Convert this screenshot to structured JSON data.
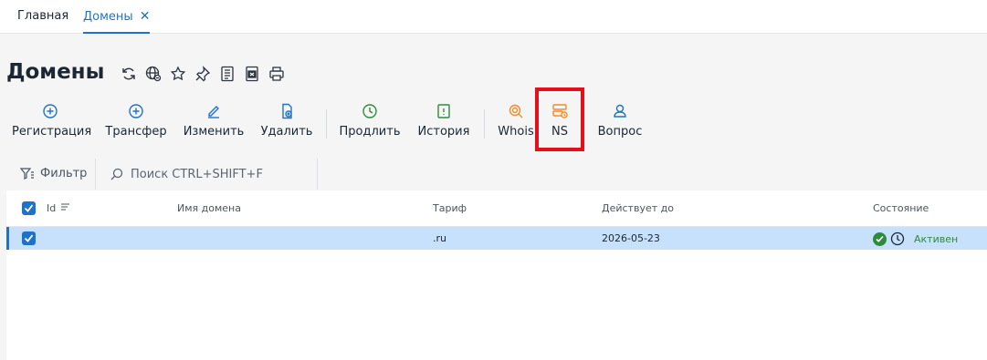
{
  "tabs": [
    {
      "label": "Главная"
    },
    {
      "label": "Домены",
      "close": "✕"
    }
  ],
  "page": {
    "title": "Домены"
  },
  "title_icons": [
    "refresh-icon",
    "globe-icon",
    "star-icon",
    "pin-icon",
    "document-icon",
    "excel-export-icon",
    "print-icon"
  ],
  "toolbar": {
    "register": "Регистрация",
    "transfer": "Трансфер",
    "edit": "Изменить",
    "delete": "Удалить",
    "renew": "Продлить",
    "history": "История",
    "whois": "Whois",
    "ns": "NS",
    "question": "Вопрос"
  },
  "filter": {
    "label": "Фильтр",
    "search_placeholder": "Поиск CTRL+SHIFT+F"
  },
  "table": {
    "headers": {
      "id": "Id",
      "name": "Имя домена",
      "tariff": "Тариф",
      "valid_until": "Действует до",
      "state": "Состояние"
    },
    "rows": [
      {
        "id": "",
        "name": "",
        "tariff": ".ru",
        "valid_until": "2026-05-23",
        "state": "Активен",
        "selected": true
      }
    ]
  },
  "colors": {
    "accent": "#1e73c8",
    "ok_green": "#2e8b3c",
    "orange": "#f08c2e",
    "highlight": "#e3101b",
    "selected_row": "#c7e0fb"
  }
}
